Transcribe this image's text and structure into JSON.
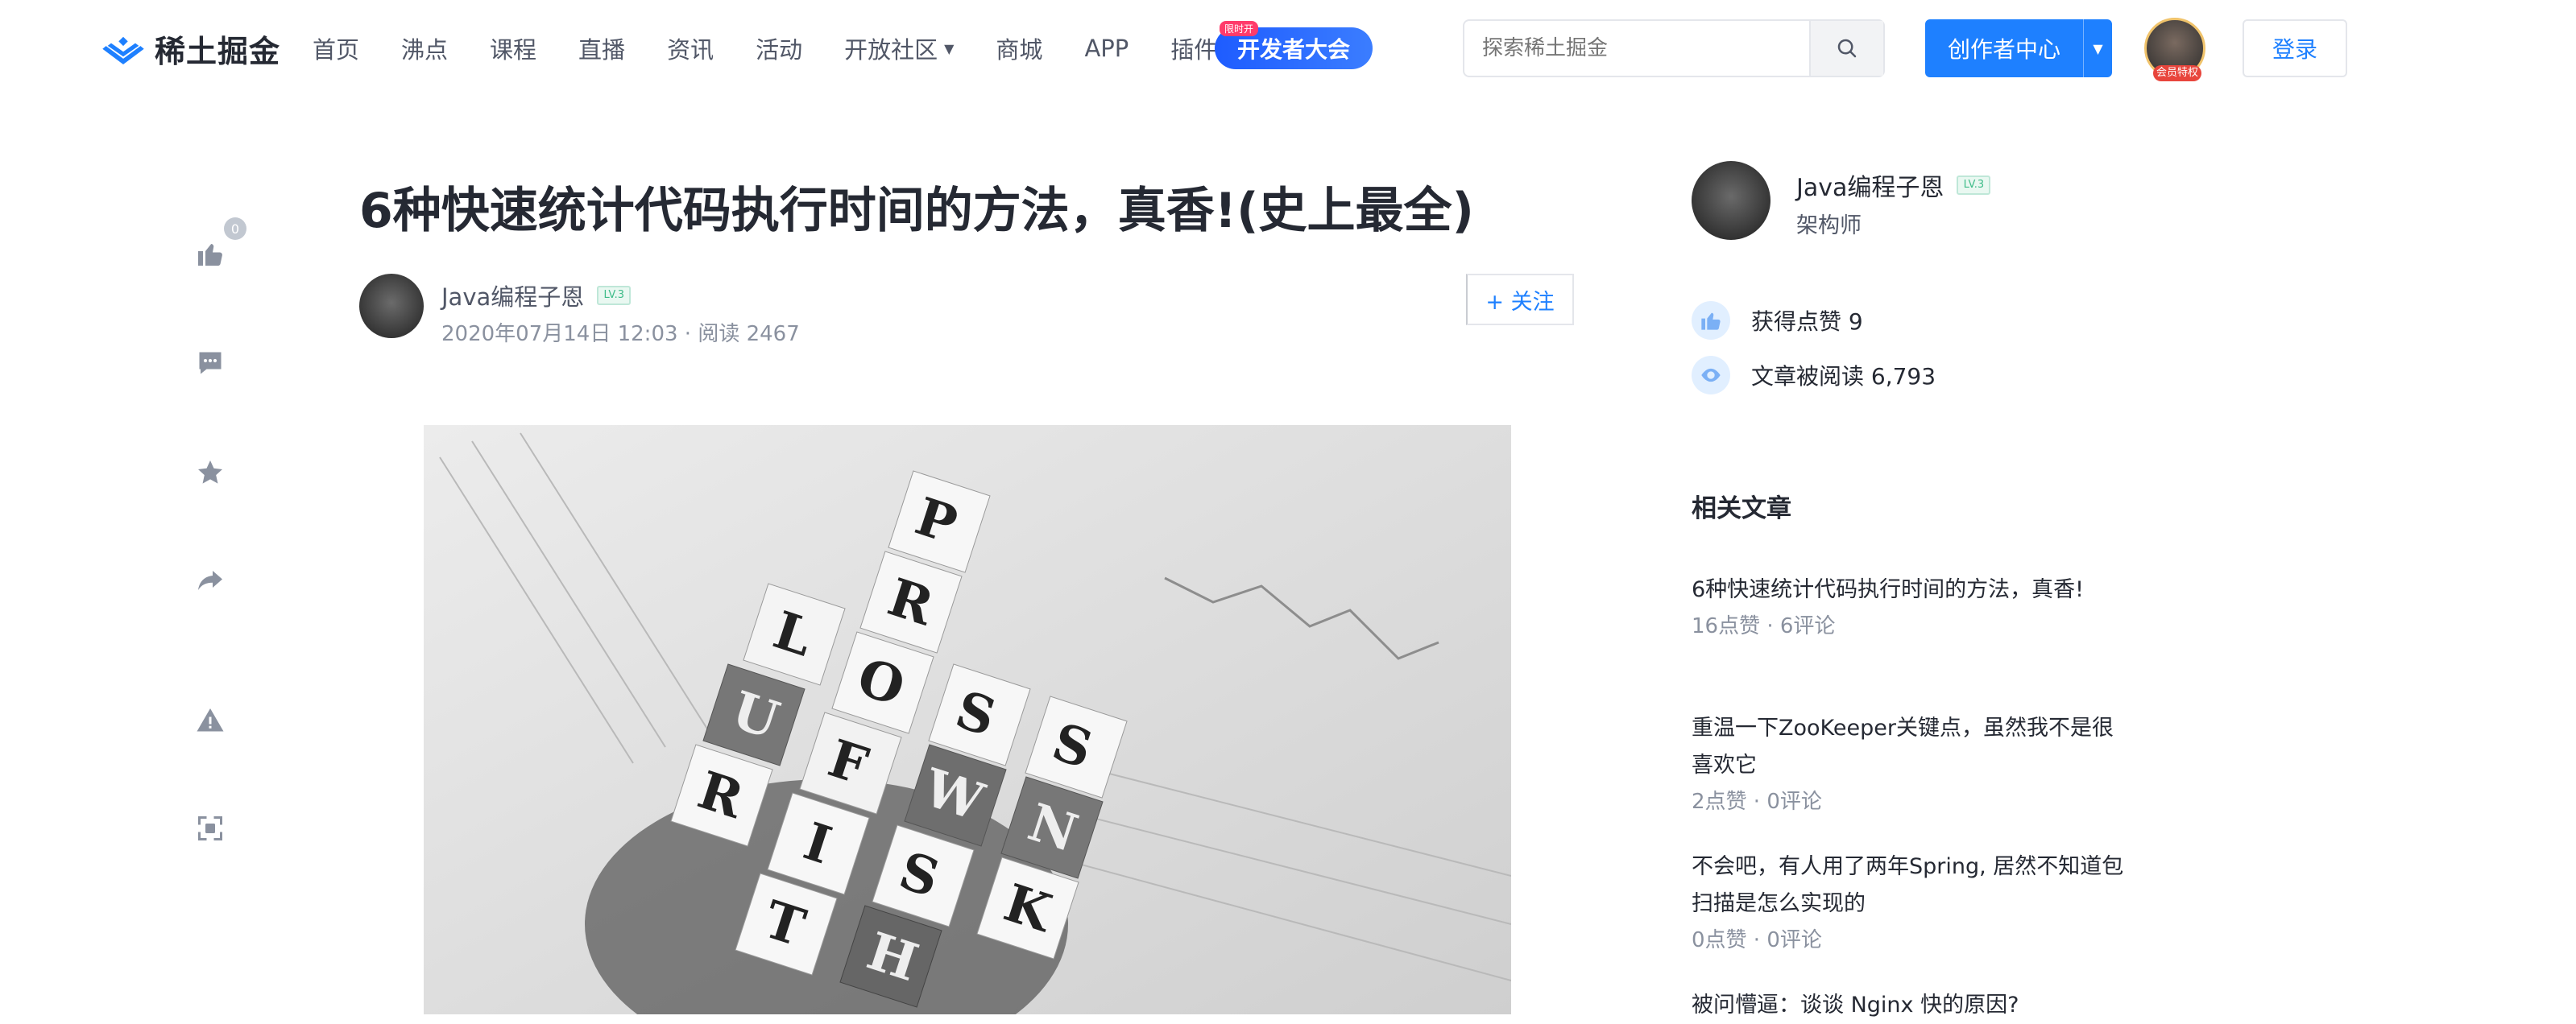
{
  "brand": {
    "name": "稀土掘金",
    "accent": "#1e80ff"
  },
  "nav": {
    "items": [
      "首页",
      "沸点",
      "课程",
      "直播",
      "资讯",
      "活动",
      "开放社区",
      "商城",
      "APP",
      "插件"
    ],
    "dev_badge": "开发者大会",
    "dev_badge_tag": "限时开"
  },
  "search": {
    "placeholder": "探索稀土掘金"
  },
  "header": {
    "creator_label": "创作者中心",
    "login_label": "登录",
    "vip_tag": "会员特权"
  },
  "actions": {
    "like_count": "0"
  },
  "article": {
    "title": "6种快速统计代码执行时间的方法，真香!(史上最全)",
    "author": "Java编程子恩",
    "level": "LV.3",
    "meta": "2020年07月14日 12:03 ·  阅读 2467",
    "follow_label": "+ 关注"
  },
  "sidebar": {
    "author": "Java编程子恩",
    "level": "LV.3",
    "job": "架构师",
    "likes_label": "获得点赞 9",
    "reads_label": "文章被阅读 6,793",
    "related_heading": "相关文章",
    "related": [
      {
        "title": "6种快速统计代码执行时间的方法，真香!",
        "meta": "16点赞 ·  6评论"
      },
      {
        "title": "重温一下ZooKeeper关键点，虽然我不是很喜欢它",
        "meta": "2点赞 ·  0评论"
      },
      {
        "title": "不会吧，有人用了两年Spring, 居然不知道包扫描是怎么实现的",
        "meta": "0点赞 ·  0评论"
      },
      {
        "title": "被问懵逼：谈谈 Nginx 快的原因?",
        "meta": ""
      }
    ]
  }
}
